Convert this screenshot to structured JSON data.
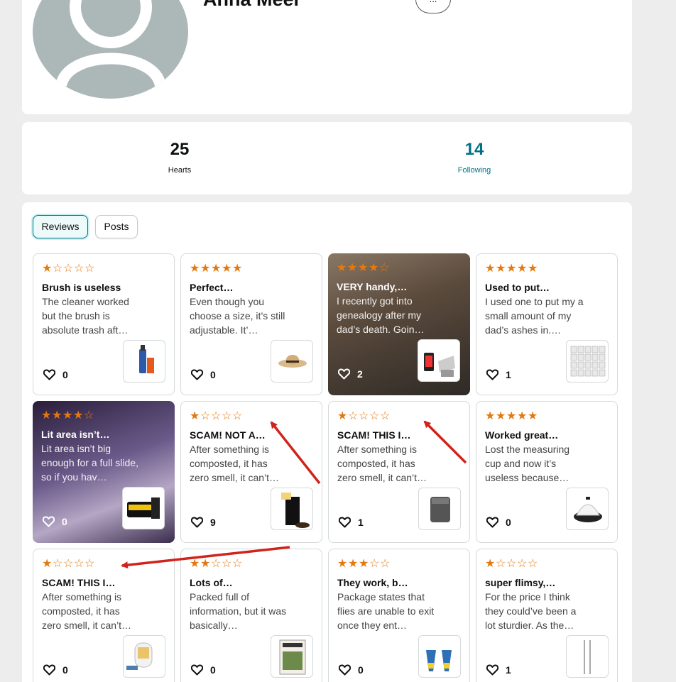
{
  "profile": {
    "name": "Anna Meer",
    "more_label": "..."
  },
  "stats": {
    "hearts_count": "25",
    "hearts_label": "Hearts",
    "following_count": "14",
    "following_label": "Following"
  },
  "tabs": [
    {
      "label": "Reviews",
      "active": true
    },
    {
      "label": "Posts",
      "active": false
    }
  ],
  "colors": {
    "star": "#e47911",
    "link": "#007185",
    "arrow": "#d0231b",
    "avatar": "#acb8b8"
  },
  "reviews": [
    {
      "rating": 1,
      "title": "Brush is useless",
      "text": "The cleaner worked but the brush is absolute trash aft…",
      "likes": "0",
      "thumb_icon": "cleaner-bottle-icon"
    },
    {
      "rating": 5,
      "title": "Perfect…",
      "text": "Even though you choose a size, it’s still adjustable. It’…",
      "likes": "0",
      "thumb_icon": "straw-hat-icon"
    },
    {
      "rating": 4,
      "title": "VERY handy,…",
      "text": "I recently got into genealogy after my dad’s death. Goin…",
      "likes": "2",
      "thumb_icon": "phone-scanner-stand-icon"
    },
    {
      "rating": 5,
      "title": "Used to put…",
      "text": "I used one to put my a small amount of my dad’s ashes in.…",
      "likes": "1",
      "thumb_icon": "small-bags-icon"
    },
    {
      "rating": 4,
      "title": "Lit area isn’t…",
      "text": "Lit area isn’t big enough for a full slide, so if you hav…",
      "likes": "0",
      "thumb_icon": "film-scanner-icon"
    },
    {
      "rating": 1,
      "title": "SCAM! NOT A…",
      "text": "After something is composted, it has zero smell, it can’t…",
      "likes": "9",
      "thumb_icon": "compost-bin-icon"
    },
    {
      "rating": 1,
      "title": "SCAM! THIS I…",
      "text": "After something is composted, it has zero smell, it can’t…",
      "likes": "1",
      "thumb_icon": "kitchen-composter-icon"
    },
    {
      "rating": 5,
      "title": "Worked great…",
      "text": "Lost the measuring cup and now it’s useless because…",
      "likes": "0",
      "thumb_icon": "egg-cooker-icon"
    },
    {
      "rating": 1,
      "title": "SCAM! THIS I…",
      "text": "After something is composted, it has zero smell, it can’t…",
      "likes": "0",
      "thumb_icon": "food-recycler-icon"
    },
    {
      "rating": 2,
      "title": "Lots of…",
      "text": "Packed full of information, but it was basically…",
      "likes": "0",
      "thumb_icon": "book-cover-icon"
    },
    {
      "rating": 3,
      "title": "They work, b…",
      "text": "Package states that flies are unable to exit once they ent…",
      "likes": "0",
      "thumb_icon": "fly-trap-bags-icon"
    },
    {
      "rating": 1,
      "title": "super flimsy,…",
      "text": "For the price I think they could’ve been a lot sturdier. As the…",
      "likes": "1",
      "thumb_icon": "metal-rods-icon"
    }
  ]
}
